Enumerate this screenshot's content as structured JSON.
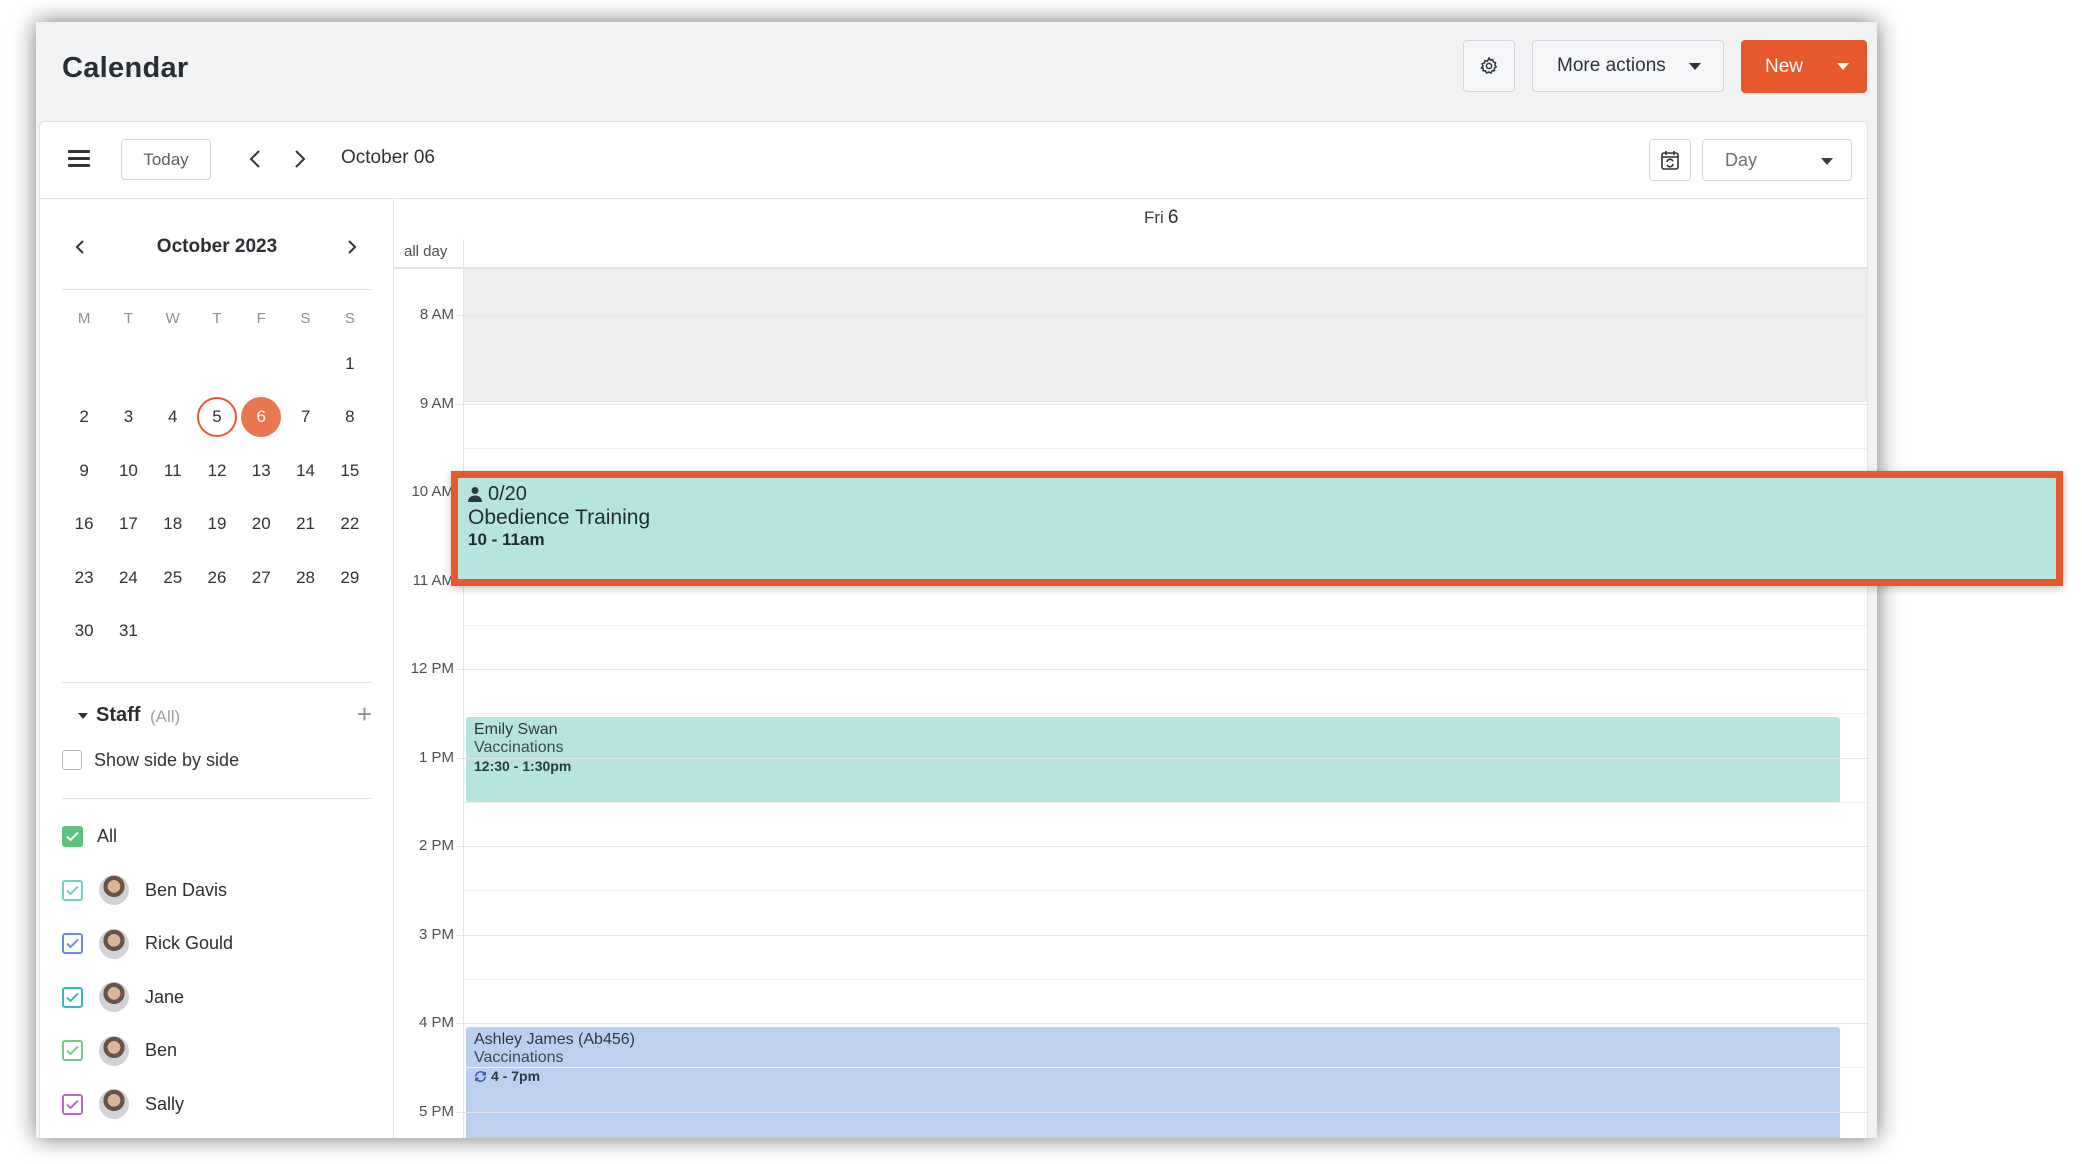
{
  "header": {
    "title": "Calendar",
    "settings_icon": "gear-icon",
    "more_actions_label": "More actions",
    "new_label": "New",
    "accent_color": "#e8582d"
  },
  "toolbar": {
    "today_label": "Today",
    "current_date": "October 06",
    "view_select": "Day"
  },
  "mini_calendar": {
    "title": "October 2023",
    "weekdays": [
      "M",
      "T",
      "W",
      "T",
      "F",
      "S",
      "S"
    ],
    "weeks": [
      [
        "",
        "",
        "",
        "",
        "",
        "",
        "1"
      ],
      [
        "2",
        "3",
        "4",
        "5",
        "6",
        "7",
        "8"
      ],
      [
        "9",
        "10",
        "11",
        "12",
        "13",
        "14",
        "15"
      ],
      [
        "16",
        "17",
        "18",
        "19",
        "20",
        "21",
        "22"
      ],
      [
        "23",
        "24",
        "25",
        "26",
        "27",
        "28",
        "29"
      ],
      [
        "30",
        "31",
        "",
        "",
        "",
        "",
        ""
      ]
    ],
    "today": "5",
    "selected": "6"
  },
  "staff": {
    "title": "Staff",
    "filter_tag": "(All)",
    "show_side_by_side": "Show side by side",
    "members": [
      {
        "name": "All",
        "color": "#5ec27a",
        "checked": true,
        "avatar": false
      },
      {
        "name": "Ben Davis",
        "color": "#6fd3c4",
        "checked": true,
        "avatar": true
      },
      {
        "name": "Rick Gould",
        "color": "#6f8de0",
        "checked": true,
        "avatar": true
      },
      {
        "name": "Jane",
        "color": "#3bb6c9",
        "checked": true,
        "avatar": true
      },
      {
        "name": "Ben",
        "color": "#7ac98a",
        "checked": true,
        "avatar": true
      },
      {
        "name": "Sally",
        "color": "#b56cc9",
        "checked": true,
        "avatar": true
      }
    ]
  },
  "day_view": {
    "day_name": "Fri",
    "day_number": "6",
    "all_day_label": "all day",
    "hours": [
      "8 AM",
      "9 AM",
      "10 AM",
      "11 AM",
      "12 PM",
      "1 PM",
      "2 PM",
      "3 PM",
      "4 PM",
      "5 PM"
    ],
    "events": [
      {
        "id": "obedience",
        "count": "0/20",
        "title": "Obedience Training",
        "time": "10 - 11am",
        "color": "#b6e5df"
      },
      {
        "id": "emily",
        "who": "Emily Swan",
        "service": "Vaccinations",
        "time": "12:30 - 1:30pm",
        "color": "#b6e5df"
      },
      {
        "id": "ashley",
        "who": "Ashley James (Ab456)",
        "service": "Vaccinations",
        "time": "4 - 7pm",
        "recurring_icon": "repeat-icon",
        "color": "#bdd0f0"
      }
    ]
  }
}
